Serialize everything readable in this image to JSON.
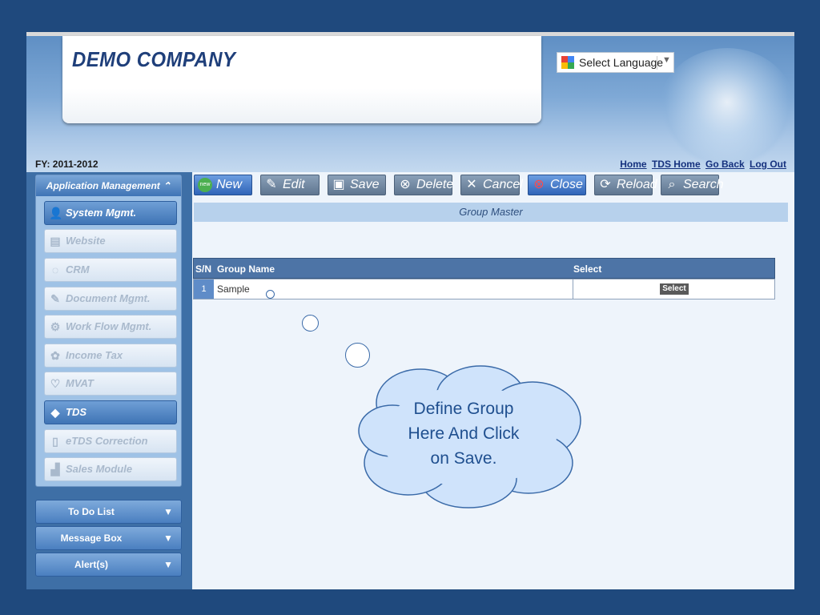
{
  "header": {
    "company_name": "DEMO COMPANY",
    "language_select": "Select Language",
    "fy_label": "FY: 2011-2012",
    "links": [
      "Home",
      "TDS Home",
      "Go Back",
      "Log Out"
    ]
  },
  "sidebar": {
    "panel_title": "Application Management",
    "modules": [
      {
        "label": "System Mgmt.",
        "icon": "person-icon",
        "active": true
      },
      {
        "label": "Website",
        "icon": "chart-icon",
        "active": false
      },
      {
        "label": "CRM",
        "icon": "crm-icon",
        "active": false
      },
      {
        "label": "Document Mgmt.",
        "icon": "document-icon",
        "active": false
      },
      {
        "label": "Work Flow Mgmt.",
        "icon": "workflow-icon",
        "active": false
      },
      {
        "label": "Income Tax",
        "icon": "income-tax-icon",
        "active": false
      },
      {
        "label": "MVAT",
        "icon": "mvat-icon",
        "active": false
      },
      {
        "label": "TDS",
        "icon": "tds-icon",
        "active": true
      },
      {
        "label": "eTDS Correction",
        "icon": "etds-icon",
        "active": false
      },
      {
        "label": "Sales Module",
        "icon": "sales-icon",
        "active": false
      }
    ],
    "collapsibles": [
      "To Do List",
      "Message Box",
      "Alert(s)"
    ]
  },
  "toolbar": {
    "new": "New",
    "edit": "Edit",
    "save": "Save",
    "delete": "Delete",
    "cancel": "Cancel",
    "close": "Close",
    "reload": "Reload",
    "search": "Search"
  },
  "main": {
    "title": "Group Master",
    "grid": {
      "columns": [
        "S/N",
        "Group Name",
        "Select"
      ],
      "rows": [
        {
          "sn": "1",
          "group_name": "Sample",
          "select_label": "Select"
        }
      ]
    }
  },
  "callout": {
    "line1": "Define Group",
    "line2": "Here And Click",
    "line3": "on Save."
  },
  "colors": {
    "background": "#1f497d",
    "accent": "#3f74b5",
    "callout_fill": "#cfe3fb"
  }
}
